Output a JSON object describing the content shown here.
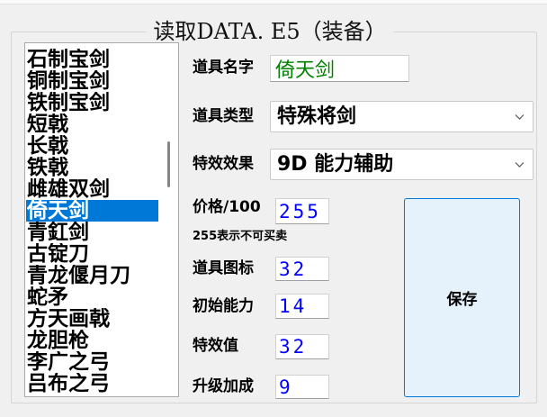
{
  "group": {
    "title": "读取DATA. E5（装备）"
  },
  "item_list": {
    "items": [
      "石制宝剑",
      "铜制宝剑",
      "铁制宝剑",
      "短戟",
      "长戟",
      "铁戟",
      "雌雄双剑",
      "倚天剑",
      "青釭剑",
      "古锭刀",
      "青龙偃月刀",
      "蛇矛",
      "方天画戟",
      "龙胆枪",
      "李广之弓",
      "吕布之弓"
    ],
    "selected_index": 7
  },
  "form": {
    "name": {
      "label": "道具名字",
      "value": "倚天剑"
    },
    "type": {
      "label": "道具类型",
      "value": "特殊将剑"
    },
    "effect": {
      "label": "特效效果",
      "value": "9D 能力辅助"
    },
    "price": {
      "label": "价格/100",
      "value": "255",
      "hint": "255表示不可买卖"
    },
    "icon": {
      "label": "道具图标",
      "value": "32"
    },
    "initial": {
      "label": "初始能力",
      "value": "14"
    },
    "effect_amount": {
      "label": "特效值",
      "value": "32"
    },
    "upgrade": {
      "label": "升级加成",
      "value": "9"
    }
  },
  "buttons": {
    "save": "保存"
  },
  "colors": {
    "selection": "#0078d7",
    "name_text": "#008000",
    "number_text": "#0000ff",
    "button_fill": "#e5f1fb",
    "button_border": "#0078d7"
  },
  "icons": {
    "dropdown": "chevron-down-icon"
  }
}
